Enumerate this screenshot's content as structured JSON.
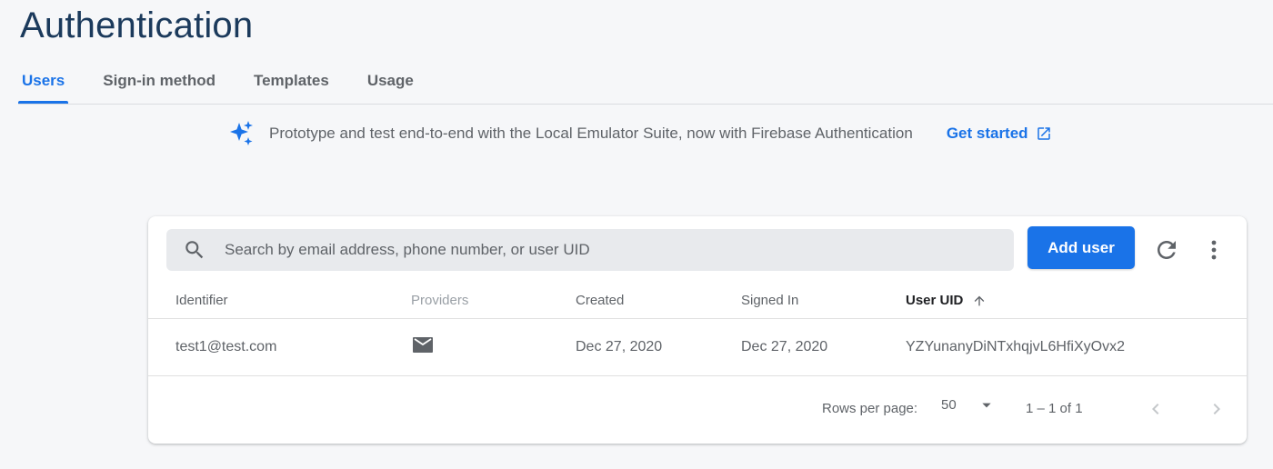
{
  "page": {
    "title": "Authentication"
  },
  "tabs": [
    {
      "label": "Users",
      "active": true
    },
    {
      "label": "Sign-in method",
      "active": false
    },
    {
      "label": "Templates",
      "active": false
    },
    {
      "label": "Usage",
      "active": false
    }
  ],
  "banner": {
    "icon": "sparkle-icon",
    "text": "Prototype and test end-to-end with the Local Emulator Suite, now with Firebase Authentication",
    "link_label": "Get started",
    "link_icon": "open-in-new-icon"
  },
  "users_table": {
    "search": {
      "placeholder": "Search by email address, phone number, or user UID",
      "value": "",
      "icon": "search-icon"
    },
    "add_user_label": "Add user",
    "refresh_icon": "refresh-icon",
    "more_icon": "more-vert-icon",
    "columns": {
      "identifier": "Identifier",
      "providers": "Providers",
      "created": "Created",
      "signed_in": "Signed In",
      "user_uid": "User UID"
    },
    "sort": {
      "column": "User UID",
      "direction": "ascending",
      "icon": "arrow-up-icon"
    },
    "rows": [
      {
        "identifier": "test1@test.com",
        "provider_icon": "mail-icon",
        "created": "Dec 27, 2020",
        "signed_in": "Dec 27, 2020",
        "user_uid": "YZYunanyDiNTxhqjvL6HfiXyOvx2"
      }
    ],
    "pagination": {
      "rows_per_page_label": "Rows per page:",
      "rows_per_page_value": "50",
      "range": "1 – 1 of 1",
      "prev_icon": "chevron-left-icon",
      "next_icon": "chevron-right-icon"
    }
  },
  "colors": {
    "accent": "#1a73e8",
    "title": "#1b3a5c",
    "background": "#f6f7f9",
    "card": "#ffffff",
    "search_bg": "#e8eaed"
  }
}
